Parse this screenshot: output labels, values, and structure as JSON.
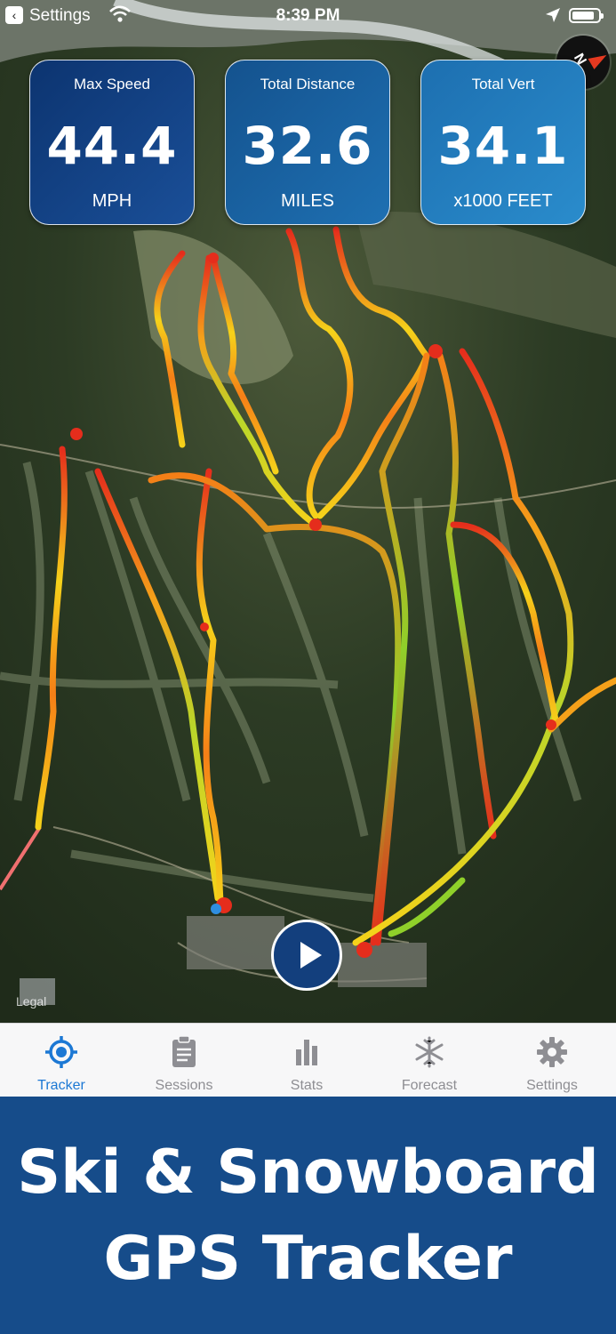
{
  "status_bar": {
    "back_label": "Settings",
    "time": "8:39 PM"
  },
  "stats": {
    "max_speed": {
      "label": "Max Speed",
      "value": "44.4",
      "unit": "MPH"
    },
    "total_distance": {
      "label": "Total Distance",
      "value": "32.6",
      "unit": "MILES"
    },
    "total_vert": {
      "label": "Total Vert",
      "value": "34.1",
      "unit": "x1000 FEET"
    }
  },
  "compass": {
    "label": "N"
  },
  "map": {
    "legal": "Legal",
    "track_colors": [
      "#e52d1c",
      "#f57f17",
      "#f5d21a",
      "#8fd02a"
    ]
  },
  "tabs": [
    {
      "label": "Tracker",
      "icon": "crosshair-icon",
      "active": true
    },
    {
      "label": "Sessions",
      "icon": "clipboard-icon"
    },
    {
      "label": "Stats",
      "icon": "bar-chart-icon"
    },
    {
      "label": "Forecast",
      "icon": "snowflake-icon"
    },
    {
      "label": "Settings",
      "icon": "gear-icon"
    }
  ],
  "banner": {
    "line1": "Ski & Snowboard",
    "line2": "GPS Tracker"
  },
  "colors": {
    "accent": "#1c78d4",
    "banner": "#164c8a",
    "play_button": "#133f7d"
  }
}
